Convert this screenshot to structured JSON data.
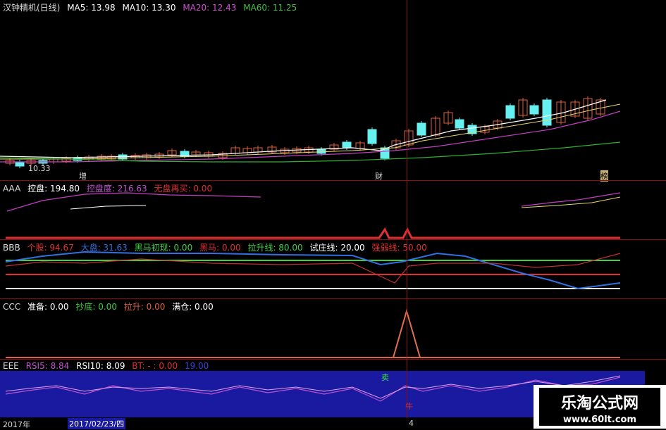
{
  "main": {
    "title": "汉钟精机(日线)",
    "ma5": "MA5: 13.98",
    "ma10": "MA10: 13.30",
    "ma20": "MA20: 12.43",
    "ma60": "MA60: 11.25",
    "low_price": "10.33",
    "markers": [
      "增",
      "财",
      "榜"
    ]
  },
  "aaa": {
    "name": "AAA",
    "label1": "控盘: 194.80",
    "label2": "控盘度: 216.63",
    "label3": "无盘再买: 0.00"
  },
  "bbb": {
    "name": "BBB",
    "l1": "个股: 94.67",
    "l2": "大盘: 31.63",
    "l3": "黑马初现: 0.00",
    "l4": "黑马: 0.00",
    "l5": "拉升线: 80.00",
    "l6": "试庄线: 20.00",
    "l7": "强弱线: 50.00"
  },
  "ccc": {
    "name": "CCC",
    "l1": "准备: 0.00",
    "l2": "抄底: 0.00",
    "l3": "拉升: 0.00",
    "l4": "满仓: 0.00"
  },
  "eee": {
    "name": "EEE",
    "l1": "RSI5: 8.84",
    "l2": "RSI10: 8.09",
    "l3": "BT: - : 0.00",
    "l4": "19.00",
    "sell": "卖",
    "bull": "牛"
  },
  "axis": {
    "year": "2017年",
    "date": "2017/02/23/四",
    "tick": "4"
  },
  "watermark": {
    "cn": "乐淘公式网",
    "url": "www.60lt.com"
  },
  "colors": {
    "up": "#e0603a",
    "down": "#66f0f0",
    "ma5": "#ffffff",
    "ma10": "#e8d870",
    "ma20": "#c040c0",
    "ma60": "#30b030",
    "separator": "#8a1010",
    "rsi_bg": "#1a1aa0"
  }
}
